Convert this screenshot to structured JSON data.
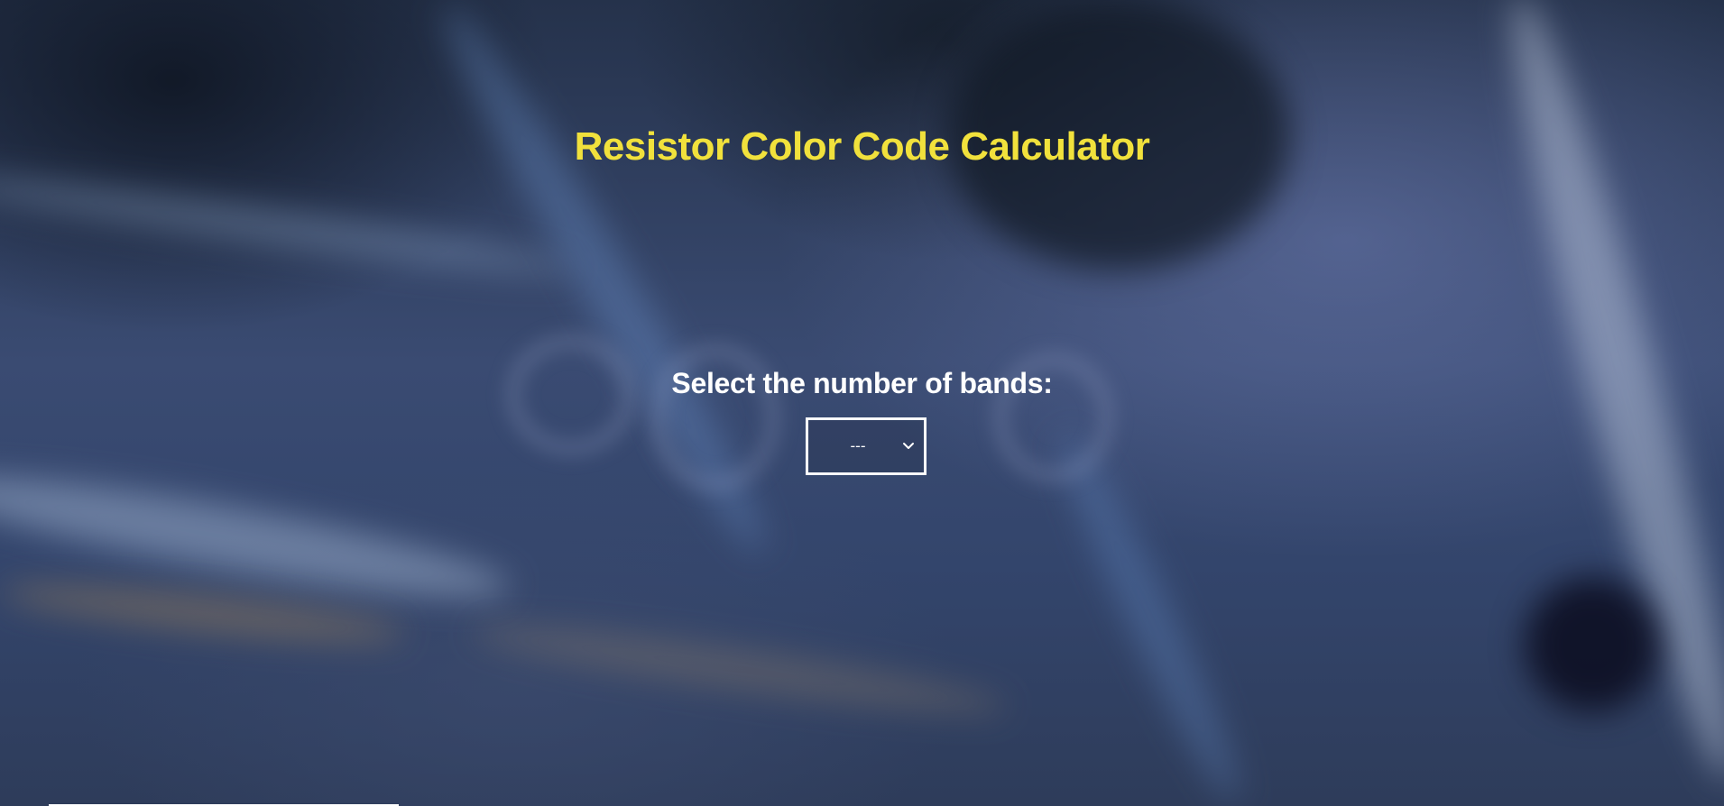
{
  "header": {
    "title": "Resistor Color Code Calculator"
  },
  "bands": {
    "label": "Select the number of bands:",
    "select": {
      "selected_value": "---",
      "icon": "chevron-down-icon"
    }
  },
  "colors": {
    "title": "#f1e13c",
    "text": "#ffffff",
    "background": "#2b3a57"
  }
}
